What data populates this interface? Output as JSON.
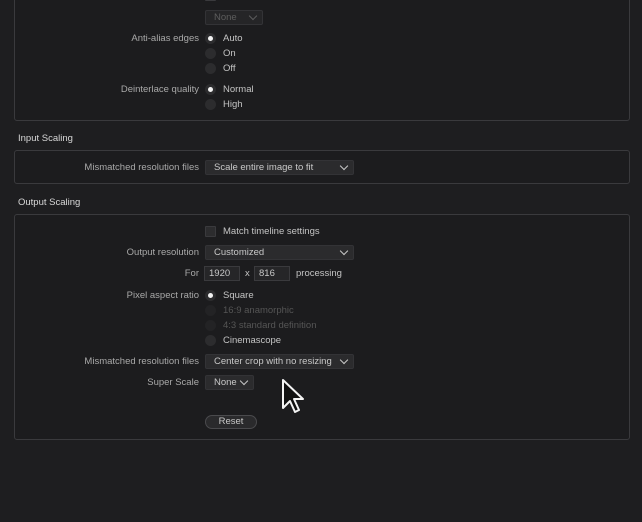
{
  "top": {
    "truncated_select": "None",
    "anti_alias": {
      "label": "Anti-alias edges",
      "options": [
        "Auto",
        "On",
        "Off"
      ],
      "selected": "Auto"
    },
    "deinterlace": {
      "label": "Deinterlace quality",
      "options": [
        "Normal",
        "High"
      ],
      "selected": "Normal"
    }
  },
  "input_scaling": {
    "title": "Input Scaling",
    "mismatched_label": "Mismatched resolution files",
    "mismatched_value": "Scale entire image to fit"
  },
  "output_scaling": {
    "title": "Output Scaling",
    "match_timeline_label": "Match timeline settings",
    "output_resolution_label": "Output resolution",
    "output_resolution_value": "Customized",
    "for_label": "For",
    "width": "1920",
    "x_label": "x",
    "height": "816",
    "processing_label": "processing",
    "pixel_aspect_label": "Pixel aspect ratio",
    "pixel_aspect_options": [
      "Square",
      "16:9 anamorphic",
      "4:3 standard definition",
      "Cinemascope"
    ],
    "pixel_aspect_selected": "Square",
    "mismatched_label": "Mismatched resolution files",
    "mismatched_value": "Center crop with no resizing",
    "super_scale_label": "Super Scale",
    "super_scale_value": "None",
    "reset_label": "Reset"
  },
  "icons": {
    "cursor": "arrow-pointer-icon",
    "dropdown": "chevron-down-icon"
  }
}
